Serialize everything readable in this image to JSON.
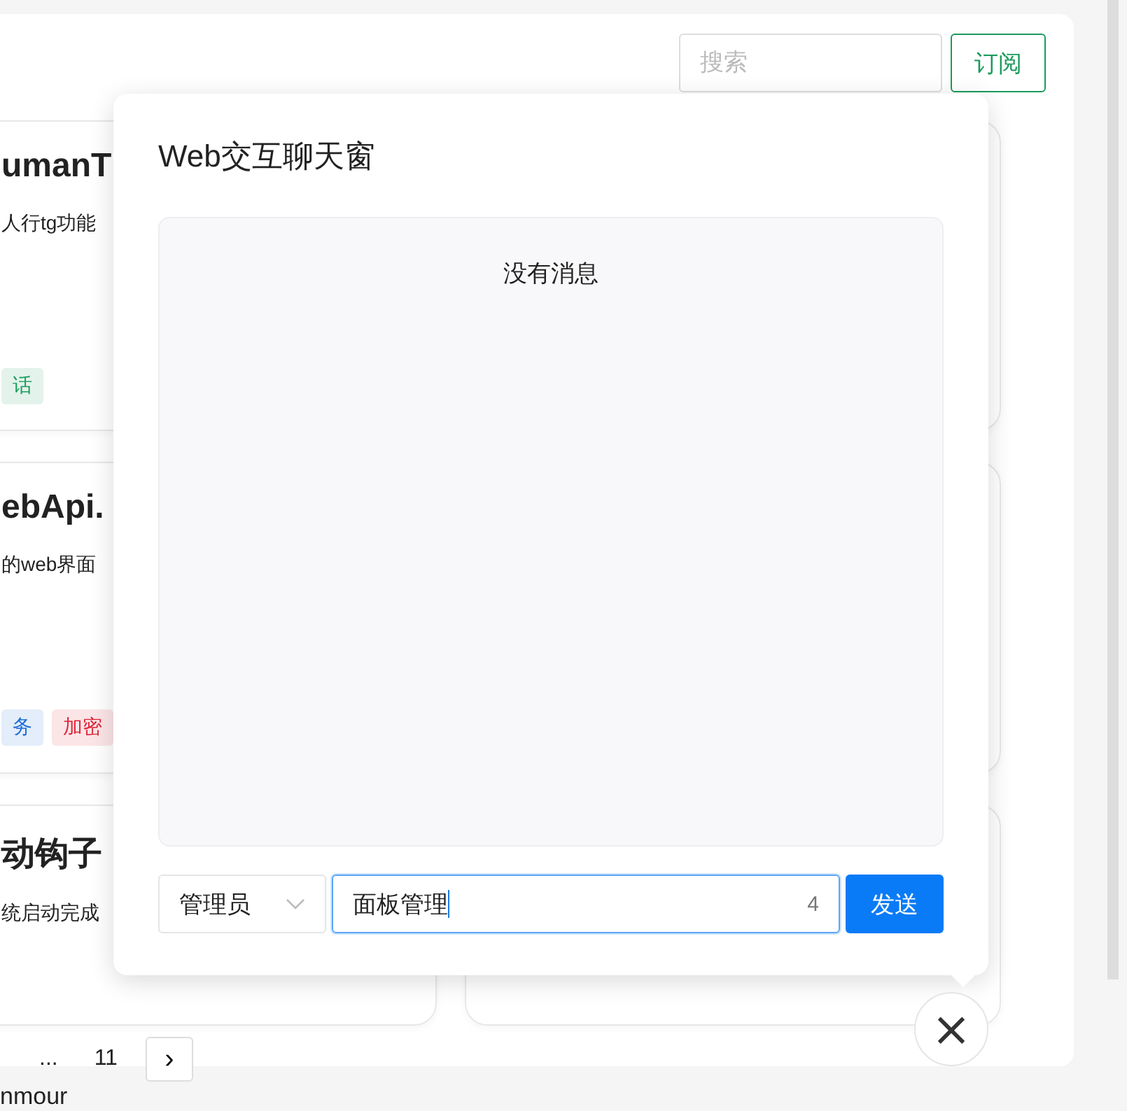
{
  "header": {
    "search": {
      "placeholder": "搜索"
    },
    "subscribe_button": "订阅"
  },
  "cards": [
    {
      "title": "umanT",
      "description": "人行tg功能",
      "tags": [
        {
          "label": "话",
          "color": "#1a9b5b"
        }
      ]
    },
    {
      "title": "ebApi.",
      "description": "的web界面",
      "tags": [
        {
          "label": "务",
          "color": "#1f6fd6"
        },
        {
          "label": "加密",
          "color": "#e0263a"
        }
      ]
    },
    {
      "title": "动钩子",
      "description": "统启动完成"
    }
  ],
  "pagination": {
    "ellipsis": "...",
    "last_page": "11",
    "next": "›"
  },
  "footer": {
    "text": "nmour"
  },
  "chat_dialog": {
    "title": "Web交互聊天窗",
    "empty_message": "没有消息",
    "role_select": {
      "value": "管理员"
    },
    "message_input": {
      "value": "面板管理",
      "count": "4",
      "focused": true
    },
    "send_button": "发送"
  },
  "close_button": "×"
}
